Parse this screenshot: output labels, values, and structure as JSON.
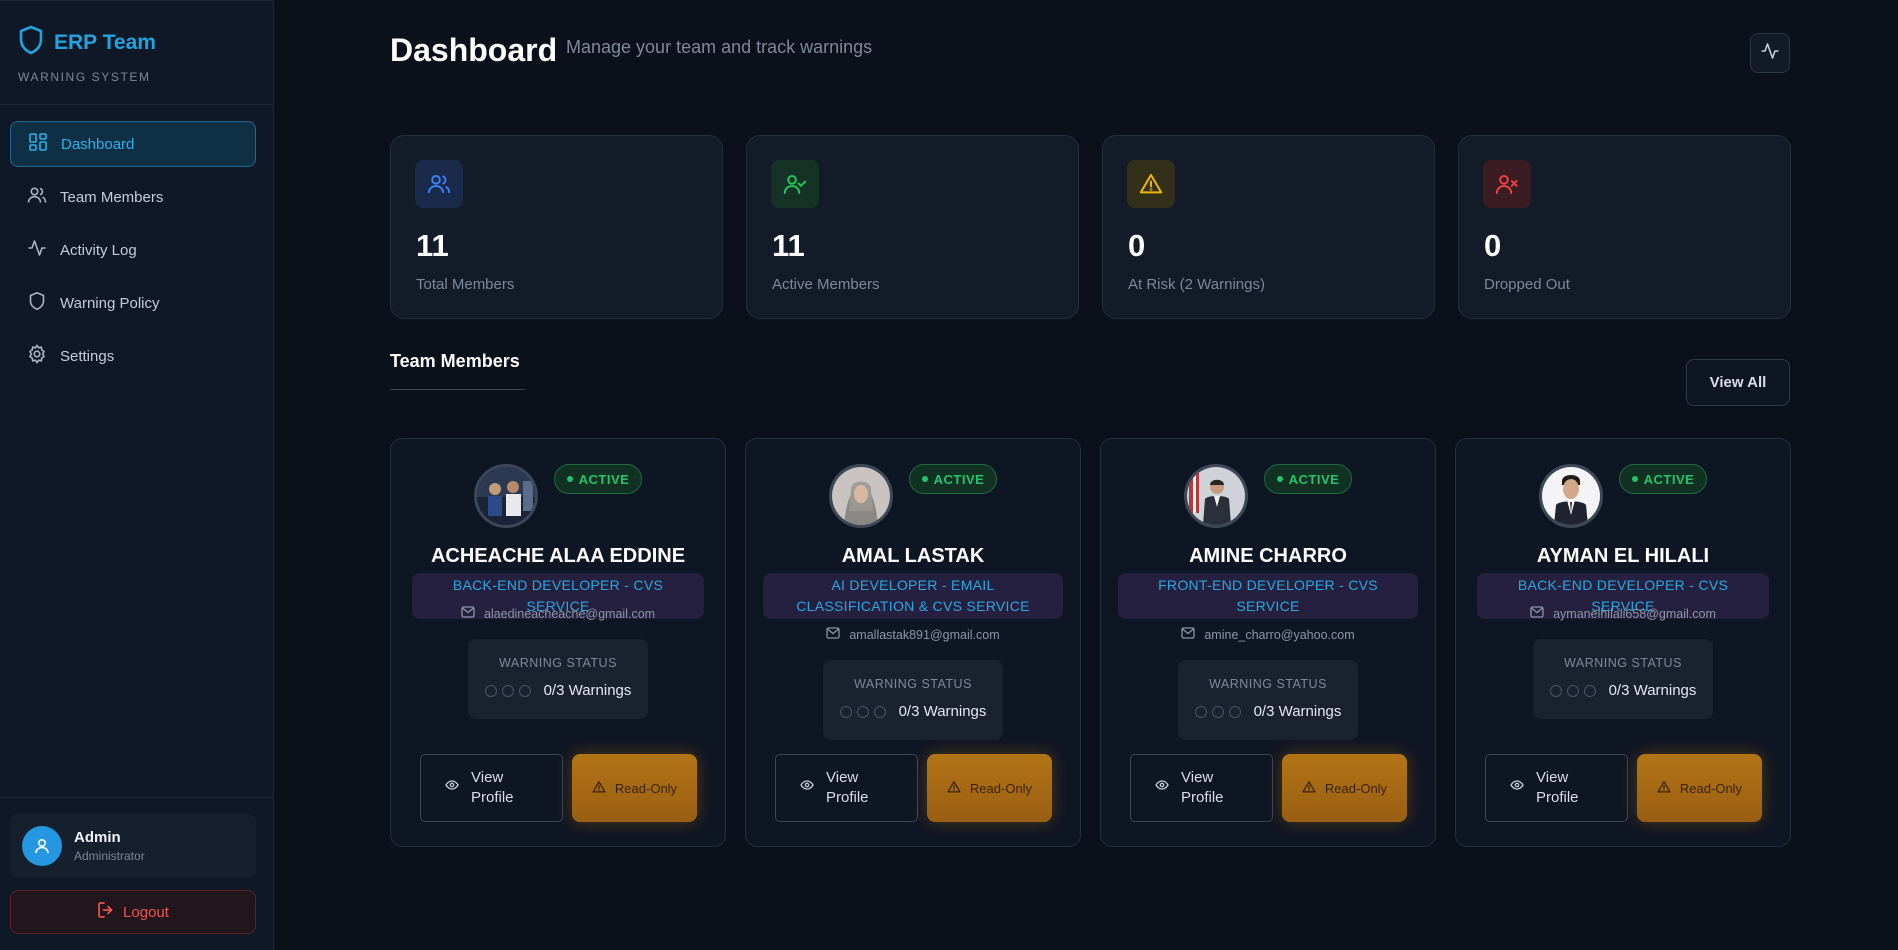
{
  "sidebar": {
    "brand_title": "ERP Team",
    "brand_subtitle": "WARNING SYSTEM",
    "items": [
      {
        "label": "Dashboard",
        "icon": "dashboard-icon",
        "active": true
      },
      {
        "label": "Team Members",
        "icon": "users-icon"
      },
      {
        "label": "Activity Log",
        "icon": "activity-icon"
      },
      {
        "label": "Warning Policy",
        "icon": "shield-icon"
      },
      {
        "label": "Settings",
        "icon": "gear-icon"
      }
    ],
    "user": {
      "name": "Admin",
      "role": "Administrator"
    },
    "logout_label": "Logout"
  },
  "header": {
    "title": "Dashboard",
    "subtitle": "Manage your team and track warnings"
  },
  "stats": [
    {
      "value": "11",
      "label": "Total Members",
      "icon": "users-icon",
      "color": "#3b82f6"
    },
    {
      "value": "11",
      "label": "Active Members",
      "icon": "user-check-icon",
      "color": "#22c55e"
    },
    {
      "value": "0",
      "label": "At Risk (2 Warnings)",
      "icon": "warning-triangle-icon",
      "color": "#eab308"
    },
    {
      "value": "0",
      "label": "Dropped Out",
      "icon": "user-x-icon",
      "color": "#ef4444"
    }
  ],
  "section": {
    "title": "Team Members",
    "view_all_label": "View All"
  },
  "members": [
    {
      "name": "ACHEACHE ALAA EDDINE",
      "status": "ACTIVE",
      "role": "BACK-END DEVELOPER - CVS SERVICE",
      "email": "alaedineacheache@gmail.com",
      "warning_label": "WARNING STATUS",
      "warnings": "0/3 Warnings",
      "view_label": "View Profile",
      "readonly_label": "Read-Only"
    },
    {
      "name": "AMAL LASTAK",
      "status": "ACTIVE",
      "role": "AI DEVELOPER - EMAIL CLASSIFICATION & CVS SERVICE",
      "email": "amallastak891@gmail.com",
      "warning_label": "WARNING STATUS",
      "warnings": "0/3 Warnings",
      "view_label": "View Profile",
      "readonly_label": "Read-Only"
    },
    {
      "name": "AMINE CHARRO",
      "status": "ACTIVE",
      "role": "FRONT-END DEVELOPER - CVS SERVICE",
      "email": "amine_charro@yahoo.com",
      "warning_label": "WARNING STATUS",
      "warnings": "0/3 Warnings",
      "view_label": "View Profile",
      "readonly_label": "Read-Only"
    },
    {
      "name": "AYMAN EL HILALI",
      "status": "ACTIVE",
      "role": "BACK-END DEVELOPER - CVS SERVICE",
      "email": "aymanelhilali658@gmail.com",
      "warning_label": "WARNING STATUS",
      "warnings": "0/3 Warnings",
      "view_label": "View Profile",
      "readonly_label": "Read-Only"
    }
  ],
  "colors": {
    "accent": "#22a3e0",
    "background": "#0b111b",
    "status_active": "#25c46b",
    "readonly": "#b27515",
    "logout": "#f05252"
  }
}
